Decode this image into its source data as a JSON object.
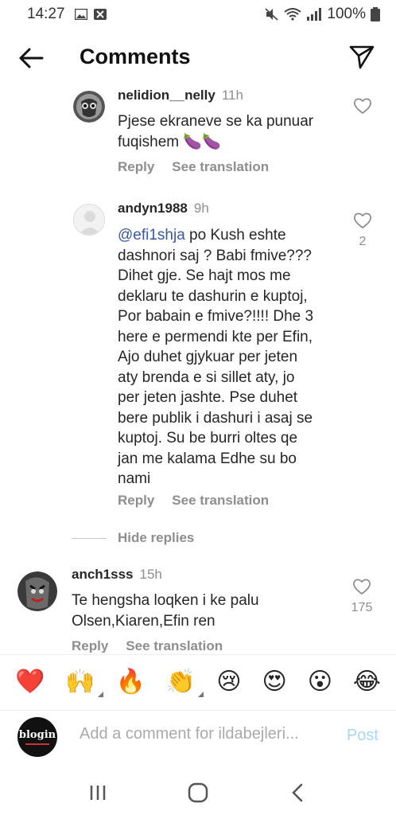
{
  "status_bar": {
    "time": "14:27",
    "battery": "100%"
  },
  "header": {
    "title": "Comments"
  },
  "comments": [
    {
      "username": "nelidion__nelly",
      "time": "11h",
      "text_lines": [
        "Pjese ekraneve se ka punuar",
        "fuqishem 🍆🍆"
      ],
      "reply_label": "Reply",
      "translate_label": "See translation",
      "likes": ""
    },
    {
      "username": "andyn1988",
      "time": "9h",
      "mention": "@efi1shja",
      "text_lines": [
        " po Kush eshte",
        "dashnori saj ? Babi fmive???",
        "Dihet gje. Se hajt mos me",
        "deklaru te dashurin e kuptoj,",
        "Por babain e fmive?!!!! Dhe 3",
        "here e permendi kte per Efin,",
        "Ajo duhet gjykuar per jeten",
        "aty brenda e si sillet aty, jo",
        "per jeten jashte. Pse duhet",
        "bere publik i dashuri i asaj se",
        "kuptoj. Su be burri oltes qe",
        "jan me kalama Edhe su bo",
        "nami"
      ],
      "reply_label": "Reply",
      "translate_label": "See translation",
      "likes": "2"
    },
    {
      "username": "anch1sss",
      "time": "15h",
      "text_lines": [
        "Te hengsha loqken i ke palu",
        "Olsen,Kiaren,Efin ren"
      ],
      "reply_label": "Reply",
      "translate_label": "See translation",
      "likes": "175"
    }
  ],
  "hide_replies": "Hide replies",
  "emoji_bar": [
    "❤️",
    "🙌",
    "🔥",
    "👏",
    "😢",
    "😍",
    "😮",
    "😂"
  ],
  "add_comment": {
    "placeholder": "Add a comment for ildabejleri...",
    "post_label": "Post",
    "avatar_text": "blogin"
  }
}
